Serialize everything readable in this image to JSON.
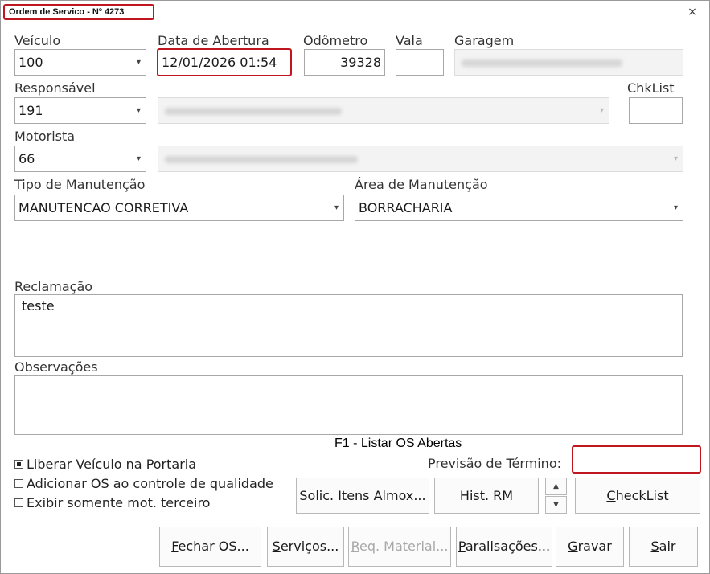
{
  "window": {
    "title": "Ordem de Servico - Nº 4273",
    "close_label": "×"
  },
  "form": {
    "veiculo": {
      "label": "Veículo",
      "value": "100"
    },
    "data_abertura": {
      "label": "Data de Abertura",
      "value": "12/01/2026 01:54"
    },
    "odometro": {
      "label": "Odômetro",
      "value": "39328"
    },
    "vala": {
      "label": "Vala",
      "value": ""
    },
    "garagem": {
      "label": "Garagem",
      "value": ""
    },
    "responsavel": {
      "label": "Responsável",
      "value": "191"
    },
    "chklist": {
      "label": "ChkList",
      "value": ""
    },
    "motorista": {
      "label": "Motorista",
      "value": "66"
    },
    "tipo_manutencao": {
      "label": "Tipo de Manutenção",
      "value": "MANUTENCAO CORRETIVA"
    },
    "area_manutencao": {
      "label": "Área de Manutenção",
      "value": "BORRACHARIA"
    },
    "reclamacao": {
      "label": "Reclamação",
      "value": "teste"
    },
    "observacoes": {
      "label": "Observações",
      "value": ""
    },
    "f1_hint": "F1 - Listar OS Abertas",
    "previsao": {
      "label": "Previsão de Término:",
      "value": ""
    }
  },
  "checkboxes": [
    {
      "label": "Liberar Veículo na Portaria",
      "checked": true
    },
    {
      "label": "Adicionar OS ao controle de qualidade",
      "checked": false
    },
    {
      "label": "Exibir somente mot. terceiro",
      "checked": false
    }
  ],
  "buttons": {
    "solic_itens": "Solic. Itens Almox...",
    "hist_rm": "Hist. RM",
    "spin_up": "▲",
    "spin_down": "▼",
    "checklist_first": "C",
    "checklist_rest": "heckList",
    "fechar_first": "F",
    "fechar_rest": "echar OS...",
    "servicos_first": "S",
    "servicos_rest": "erviços...",
    "req_first": "R",
    "req_rest": "eq. Material...",
    "paralisacoes_first": "P",
    "paralisacoes_rest": "aralisações...",
    "gravar_first": "G",
    "gravar_rest": "ravar",
    "sair_first": "S",
    "sair_rest": "air"
  },
  "icons": {
    "dropdown": "▾"
  }
}
